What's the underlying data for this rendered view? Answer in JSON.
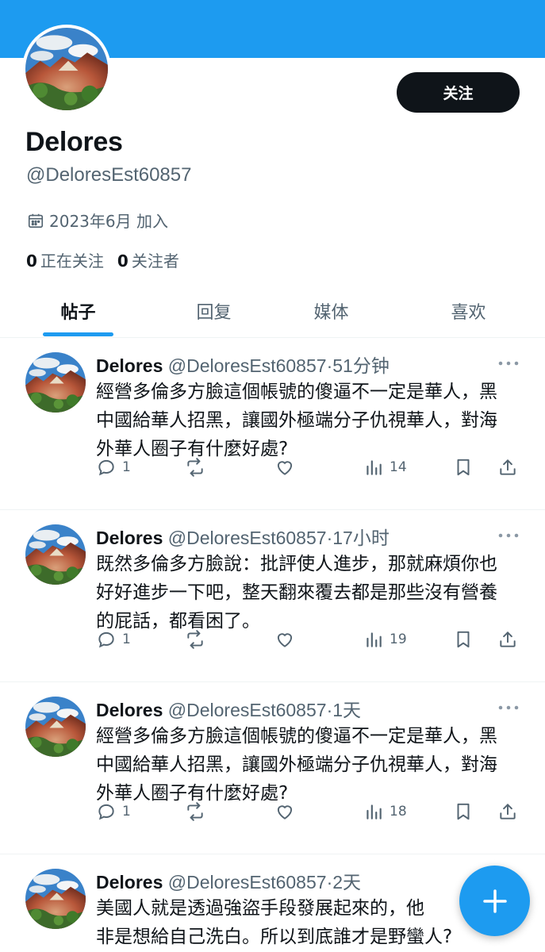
{
  "profile": {
    "display_name": "Delores",
    "handle": "@DeloresEst60857",
    "joined": "2023年6月 加入",
    "following_count": "0",
    "following_label": "正在关注",
    "followers_count": "0",
    "followers_label": "关注者",
    "follow_button": "关注"
  },
  "tabs": [
    "帖子",
    "回复",
    "媒体",
    "喜欢"
  ],
  "posts": [
    {
      "name": "Delores",
      "handle": "@DeloresEst60857",
      "time": "51分钟",
      "text": "經營多倫多方臉這個帳號的傻逼不一定是華人，黑中國給華人招黑，讓國外極端分子仇視華人，對海外華人圈子有什麼好處?",
      "replies": "1",
      "views": "14"
    },
    {
      "name": "Delores",
      "handle": "@DeloresEst60857",
      "time": "17小时",
      "text": "既然多倫多方臉說：批評使人進步，那就麻煩你也好好進步一下吧，整天翻來覆去都是那些沒有營養的屁話，都看困了。",
      "replies": "1",
      "views": "19"
    },
    {
      "name": "Delores",
      "handle": "@DeloresEst60857",
      "time": "1天",
      "text": "經營多倫多方臉這個帳號的傻逼不一定是華人，黑中國給華人招黑，讓國外極端分子仇視華人，對海外華人圈子有什麼好處?",
      "replies": "1",
      "views": "18"
    },
    {
      "name": "Delores",
      "handle": "@DeloresEst60857",
      "time": "2天",
      "text": "美國人就是透過強盜手段發展起來的，他\n非是想給自己洗白。所以到底誰才是野蠻人?"
    }
  ],
  "colors": {
    "accent": "#1d9bf0",
    "text_primary": "#0f1419",
    "text_secondary": "#536471"
  },
  "icons": [
    "calendar-icon",
    "reply-icon",
    "repost-icon",
    "like-icon",
    "views-icon",
    "bookmark-icon",
    "share-icon",
    "more-icon",
    "compose-plus-icon"
  ]
}
